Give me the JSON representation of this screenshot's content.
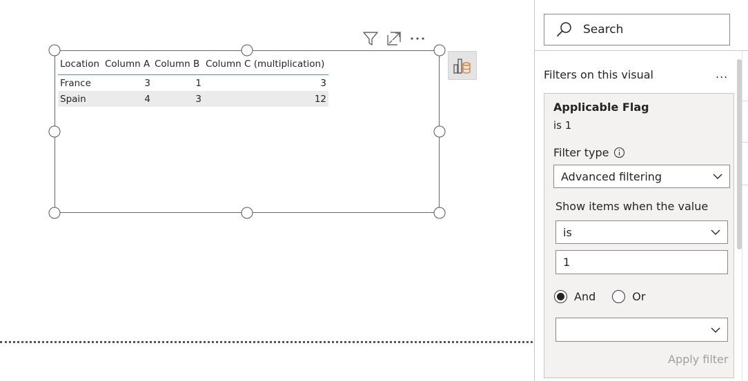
{
  "visual_header": {
    "filter_icon": "filter-icon",
    "focus_icon": "focus-mode-icon",
    "more_label": "···"
  },
  "table": {
    "columns": [
      "Location",
      "Column A",
      "Column B",
      "Column C (multiplication)"
    ],
    "rows": [
      [
        "France",
        "3",
        "1",
        "3"
      ],
      [
        "Spain",
        "4",
        "3",
        "12"
      ]
    ]
  },
  "format_button_icon": "analytics-format-icon",
  "filters_pane": {
    "search_placeholder": "Search",
    "section_title": "Filters on this visual",
    "section_more": "...",
    "card": {
      "title": "Applicable Flag",
      "summary": "is 1",
      "filter_type_label": "Filter type",
      "filter_type_value": "Advanced filtering",
      "show_items_label": "Show items when the value",
      "condition1_operator": "is",
      "condition1_value": "1",
      "logic_and": "And",
      "logic_or": "Or",
      "logic_selected": "And",
      "condition2_operator": "",
      "apply_label": "Apply filter"
    }
  },
  "colors": {
    "header_rule": "#4a90c8",
    "alt_row": "#ebebeb",
    "card_bg": "#f3f2f1",
    "disabled_text": "#a19f9d"
  }
}
